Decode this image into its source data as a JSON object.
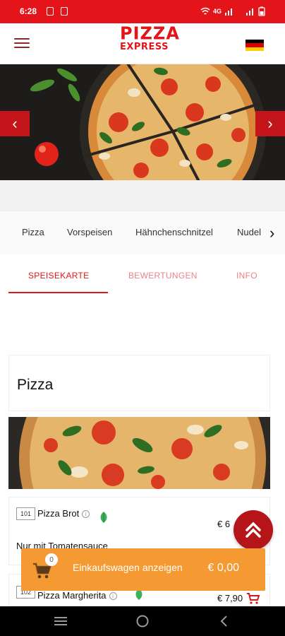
{
  "status_bar": {
    "time": "6:28",
    "right_text": "4G"
  },
  "header": {
    "logo_line1": "PIZZA",
    "logo_line2": "EXPRESS",
    "language_flag": "germany-flag-icon"
  },
  "categories": [
    "Pizza",
    "Vorspeisen",
    "Hähnchenschnitzel",
    "Nudel"
  ],
  "tabs": [
    {
      "label": "SPEISEKARTE",
      "active": true
    },
    {
      "label": "BEWERTUNGEN",
      "active": false
    },
    {
      "label": "INFO",
      "active": false
    }
  ],
  "section": {
    "title": "Pizza"
  },
  "items": [
    {
      "number": "101",
      "name": "Pizza Brot",
      "price": "€ 6",
      "description": "Nur mit Tomatensauce"
    },
    {
      "number": "102",
      "name": "Pizza Margherita",
      "price": "€ 7,90"
    }
  ],
  "cart": {
    "count": "0",
    "label": "Einkaufswagen anzeigen",
    "total": "€ 0,00"
  },
  "colors": {
    "brand_red": "#e3151b",
    "cart_orange": "#f59a32",
    "tab_inactive": "#e8848a"
  }
}
